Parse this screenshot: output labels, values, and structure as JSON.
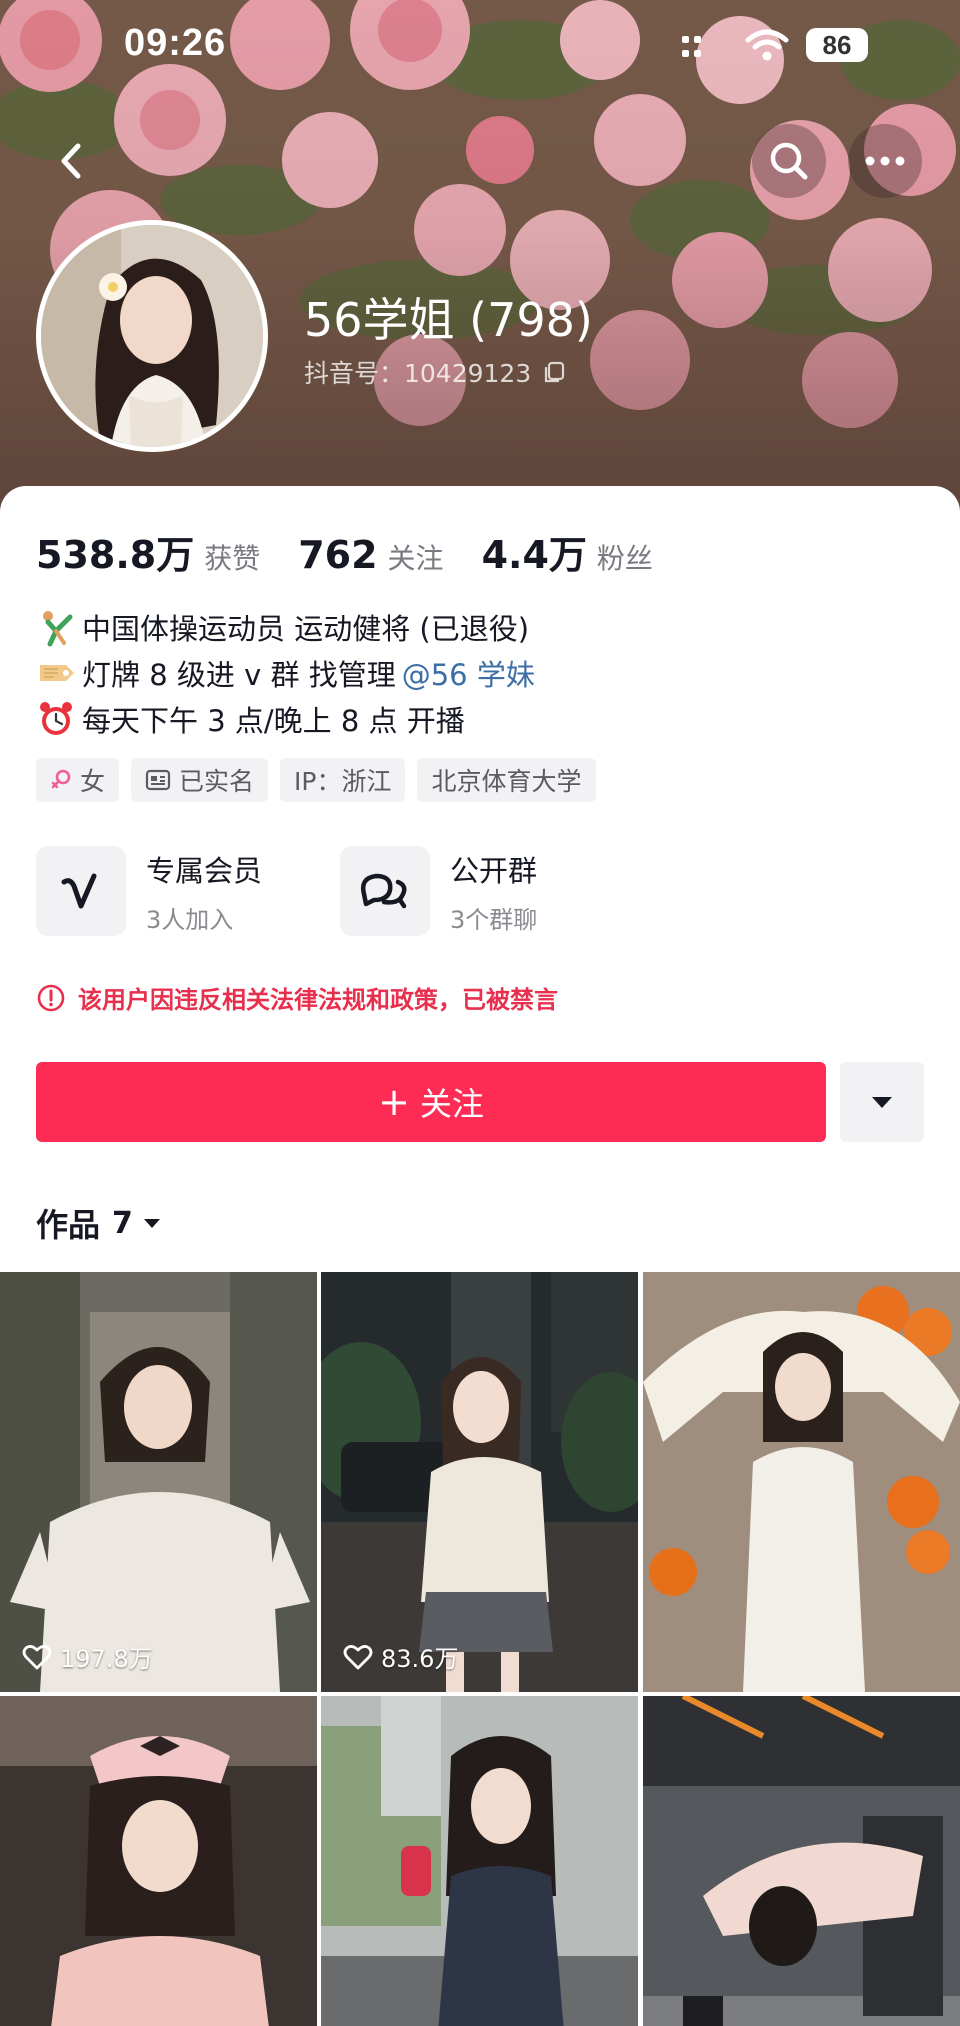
{
  "status_bar": {
    "time": "09:26",
    "battery": "86"
  },
  "profile": {
    "nickname": "56学姐 (798)",
    "douyin_id": "抖音号：10429123"
  },
  "stats": [
    {
      "value": "538.8万",
      "label": "获赞"
    },
    {
      "value": "762",
      "label": "关注"
    },
    {
      "value": "4.4万",
      "label": "粉丝"
    }
  ],
  "bio": {
    "line1": "中国体操运动员 运动健将 (已退役)",
    "line2_prefix": "灯牌 8 级进 v 群 找管理",
    "line2_mention": "@56 学妹",
    "line3": "每天下午 3 点/晚上 8 点 开播"
  },
  "tags": [
    "女",
    "已实名",
    "IP：浙江",
    "北京体育大学"
  ],
  "services": [
    {
      "title": "专属会员",
      "subtitle": "3人加入",
      "icon": "v-badge-icon"
    },
    {
      "title": "公开群",
      "subtitle": "3个群聊",
      "icon": "chat-bubbles-icon"
    }
  ],
  "ban_notice": "该用户因违反相关法律法规和政策，已被禁言",
  "actions": {
    "follow_label": "关注"
  },
  "works": {
    "label": "作品",
    "count": "7"
  },
  "videos": [
    {
      "likes": "197.8万"
    },
    {
      "likes": "83.6万"
    },
    {
      "likes": ""
    },
    {
      "likes": ""
    },
    {
      "likes": ""
    },
    {
      "likes": ""
    }
  ],
  "colors": {
    "accent": "#fe2c55",
    "warning": "#e8304e",
    "mention": "#3d6ea5"
  }
}
